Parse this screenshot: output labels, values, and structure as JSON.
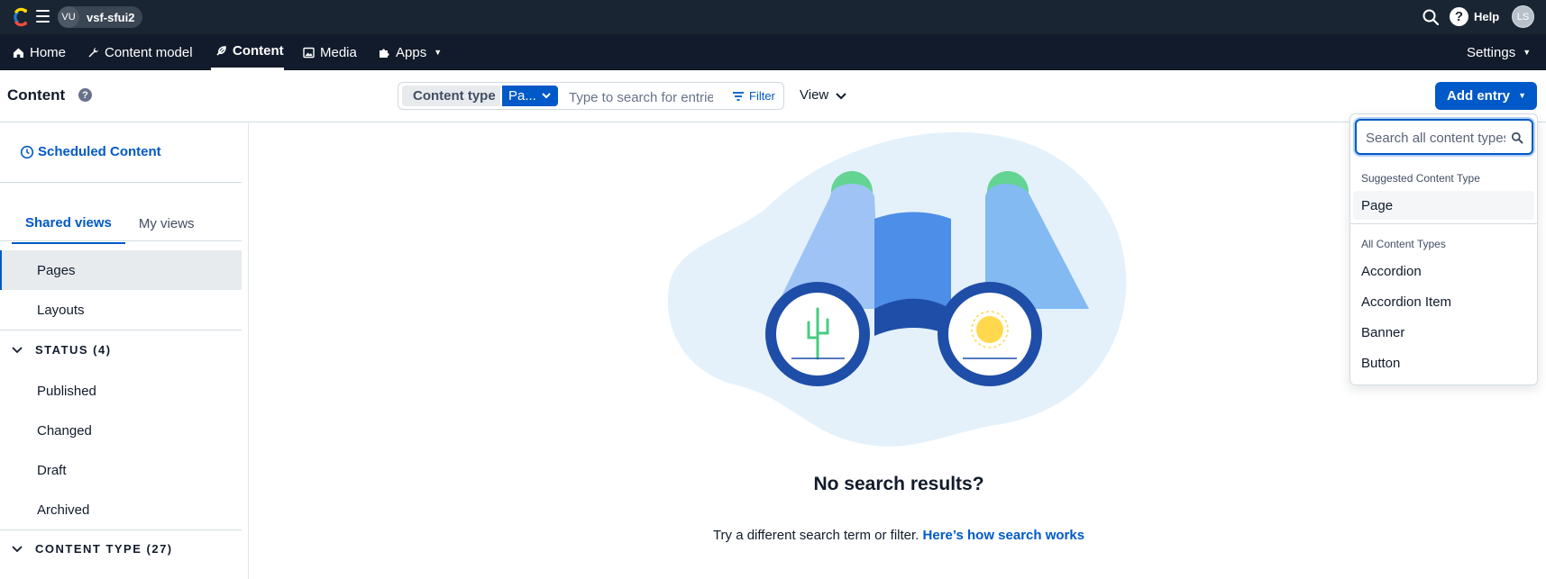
{
  "topbar": {
    "logo_icon": "contentful-logo-icon",
    "space_initials": "VU",
    "space_name": "vsf-sfui2",
    "help_label": "Help",
    "user_initials": "LS"
  },
  "nav": {
    "items": [
      {
        "label": "Home",
        "icon": "home-icon"
      },
      {
        "label": "Content model",
        "icon": "wrench-icon"
      },
      {
        "label": "Content",
        "icon": "feather-icon",
        "active": true
      },
      {
        "label": "Media",
        "icon": "image-icon"
      },
      {
        "label": "Apps",
        "icon": "puzzle-icon"
      }
    ],
    "settings_label": "Settings"
  },
  "header": {
    "title": "Content",
    "content_type_label": "Content type",
    "content_type_value": "Pa...",
    "search_placeholder": "Type to search for entries",
    "filter_label": "Filter",
    "view_label": "View",
    "add_entry_label": "Add entry"
  },
  "sidebar": {
    "scheduled_label": "Scheduled Content",
    "tabs": [
      "Shared views",
      "My views"
    ],
    "views": [
      "Pages",
      "Layouts"
    ],
    "status_group": "STATUS (4)",
    "status_items": [
      "Published",
      "Changed",
      "Draft",
      "Archived"
    ],
    "content_type_group": "CONTENT TYPE (27)"
  },
  "empty_state": {
    "title": "No search results?",
    "text": "Try a different search term or filter.",
    "link": "Here’s how search works"
  },
  "dropdown": {
    "search_placeholder": "Search all content types",
    "suggested_heading": "Suggested Content Type",
    "suggested_items": [
      "Page"
    ],
    "all_heading": "All Content Types",
    "all_items": [
      "Accordion",
      "Accordion Item",
      "Banner",
      "Button"
    ]
  },
  "colors": {
    "topbar_bg": "#192532",
    "navbar_bg": "#111b2b",
    "primary": "#0059c8"
  }
}
